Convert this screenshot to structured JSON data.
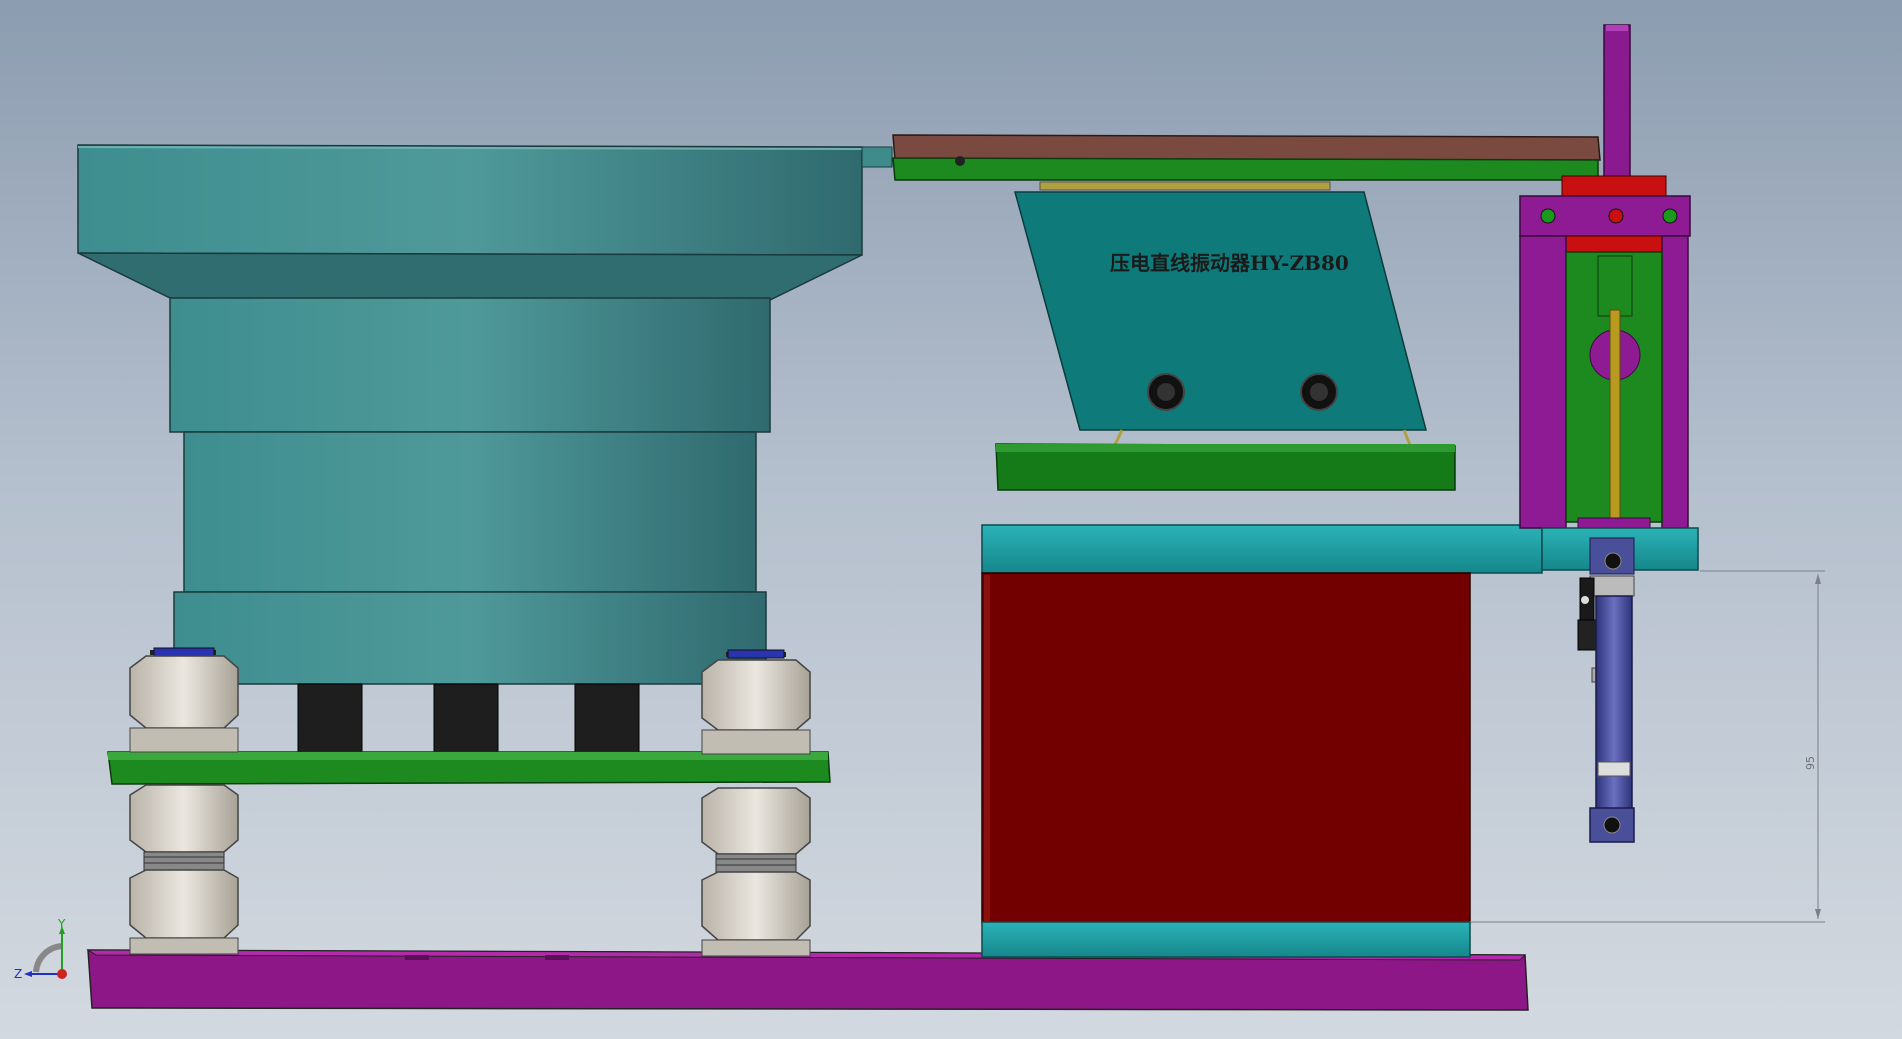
{
  "drawing": {
    "vibrator_label": "压电直线振动器HY-ZB80",
    "dimension_value": "95"
  },
  "triad": {
    "y_label": "Y",
    "z_label": "Z"
  },
  "colors": {
    "bowl": "#3f8a8c",
    "green_plate": "#16801a",
    "magenta_base": "#9a1894",
    "red_block": "#720000",
    "teal_plate": "#1b9ea2",
    "nut": "#c9c4bb",
    "cylinder": "#4a4f9a"
  }
}
